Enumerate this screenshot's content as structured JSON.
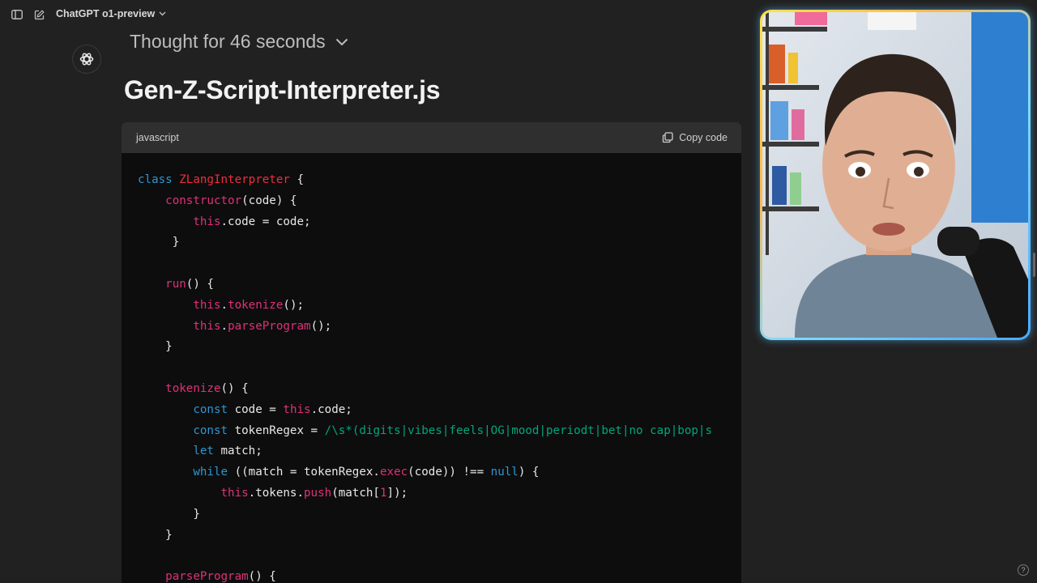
{
  "topbar": {
    "sidebar_icon": "sidebar-toggle-icon",
    "new_chat_icon": "compose-icon",
    "model_name": "ChatGPT o1-preview"
  },
  "message": {
    "avatar_icon": "openai-logo-icon",
    "thought_label": "Thought for 46 seconds",
    "title": "Gen-Z-Script-Interpreter.js"
  },
  "code": {
    "language": "javascript",
    "copy_label": "Copy code",
    "lines": [
      [
        [
          "kw",
          "class "
        ],
        [
          "cls",
          "ZLangInterpreter"
        ],
        [
          "p",
          " {"
        ]
      ],
      [
        [
          "p",
          "    "
        ],
        [
          "fn",
          "constructor"
        ],
        [
          "p",
          "(code) {"
        ]
      ],
      [
        [
          "p",
          "        "
        ],
        [
          "this",
          "this"
        ],
        [
          "p",
          ".code = code;"
        ]
      ],
      [
        [
          "p",
          "     }"
        ]
      ],
      [
        [
          "p",
          ""
        ]
      ],
      [
        [
          "p",
          "    "
        ],
        [
          "fn",
          "run"
        ],
        [
          "p",
          "() {"
        ]
      ],
      [
        [
          "p",
          "        "
        ],
        [
          "this",
          "this"
        ],
        [
          "p",
          "."
        ],
        [
          "fn",
          "tokenize"
        ],
        [
          "p",
          "();"
        ]
      ],
      [
        [
          "p",
          "        "
        ],
        [
          "this",
          "this"
        ],
        [
          "p",
          "."
        ],
        [
          "fn",
          "parseProgram"
        ],
        [
          "p",
          "();"
        ]
      ],
      [
        [
          "p",
          "    }"
        ]
      ],
      [
        [
          "p",
          ""
        ]
      ],
      [
        [
          "p",
          "    "
        ],
        [
          "fn",
          "tokenize"
        ],
        [
          "p",
          "() {"
        ]
      ],
      [
        [
          "p",
          "        "
        ],
        [
          "kw",
          "const"
        ],
        [
          "p",
          " code = "
        ],
        [
          "this",
          "this"
        ],
        [
          "p",
          ".code;"
        ]
      ],
      [
        [
          "p",
          "        "
        ],
        [
          "kw",
          "const"
        ],
        [
          "p",
          " tokenRegex = "
        ],
        [
          "str",
          "/\\s*(digits|vibes|feels|OG|mood|periodt|bet|no cap|bop|s"
        ]
      ],
      [
        [
          "p",
          "        "
        ],
        [
          "kw",
          "let"
        ],
        [
          "p",
          " match;"
        ]
      ],
      [
        [
          "p",
          "        "
        ],
        [
          "kw",
          "while"
        ],
        [
          "p",
          " ((match = tokenRegex."
        ],
        [
          "fn",
          "exec"
        ],
        [
          "p",
          "(code)) !== "
        ],
        [
          "kw",
          "null"
        ],
        [
          "p",
          ") {"
        ]
      ],
      [
        [
          "p",
          "            "
        ],
        [
          "this",
          "this"
        ],
        [
          "p",
          ".tokens."
        ],
        [
          "fn",
          "push"
        ],
        [
          "p",
          "(match["
        ],
        [
          "num",
          "1"
        ],
        [
          "p",
          "]);"
        ]
      ],
      [
        [
          "p",
          "        }"
        ]
      ],
      [
        [
          "p",
          "    }"
        ]
      ],
      [
        [
          "p",
          ""
        ]
      ],
      [
        [
          "p",
          "    "
        ],
        [
          "fn",
          "parseProgram"
        ],
        [
          "p",
          "() {"
        ]
      ]
    ]
  },
  "help_label": "?"
}
